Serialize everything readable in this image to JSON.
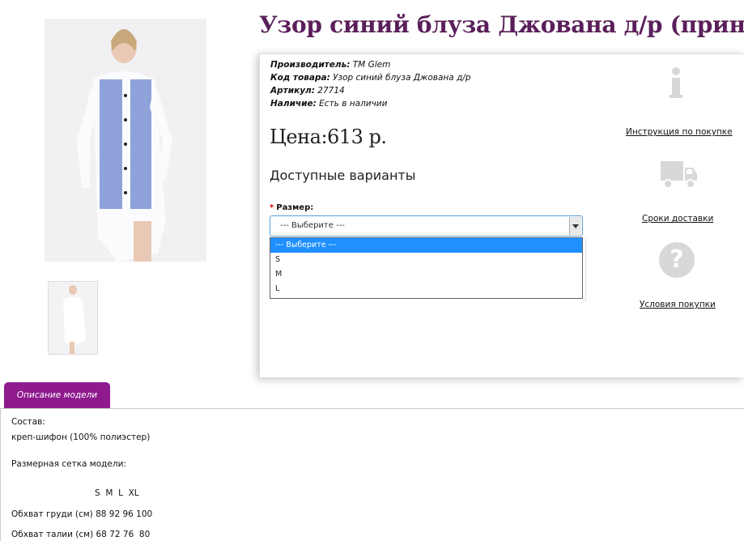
{
  "product": {
    "title": "Узор синий блуза Джована д/р (принт)",
    "manufacturer_label": "Производитель:",
    "manufacturer_value": "TM Glem",
    "code_label": "Код товара:",
    "code_value": "Узор синий блуза Джована д/р",
    "sku_label": "Артикул:",
    "sku_value": "27714",
    "availability_label": "Наличие:",
    "availability_value": "Есть в наличии",
    "price": "Цена:613 р.",
    "variants_heading": "Доступные варианты"
  },
  "size": {
    "required_mark": "*",
    "label": "Размер:",
    "selected": "--- Выберите ---",
    "options": [
      "--- Выберите ---",
      "S",
      "M",
      "L"
    ]
  },
  "side_links": {
    "instructions": "Инструкция по покупке",
    "delivery": "Сроки доставки",
    "terms": "Условия покупки"
  },
  "icons": {
    "info": "info-icon",
    "truck": "truck-icon",
    "question": "question-icon"
  },
  "tabs": {
    "description": "Описание модели"
  },
  "description": {
    "composition_label": "Состав:",
    "composition_value": "креп-шифон (100% полиэстер)",
    "size_chart_label": "Размерная сетка модели:",
    "size_header": "S  M  L  XL",
    "chest": "Обхват груди (см) 88 92 96 100",
    "waist": "Обхват талии (см) 68 72 76  80"
  },
  "colors": {
    "title": "#5a1f5a",
    "tab": "#8e1a8e",
    "select_border": "#5a9fd6",
    "selected_option": "#1e90ff"
  }
}
